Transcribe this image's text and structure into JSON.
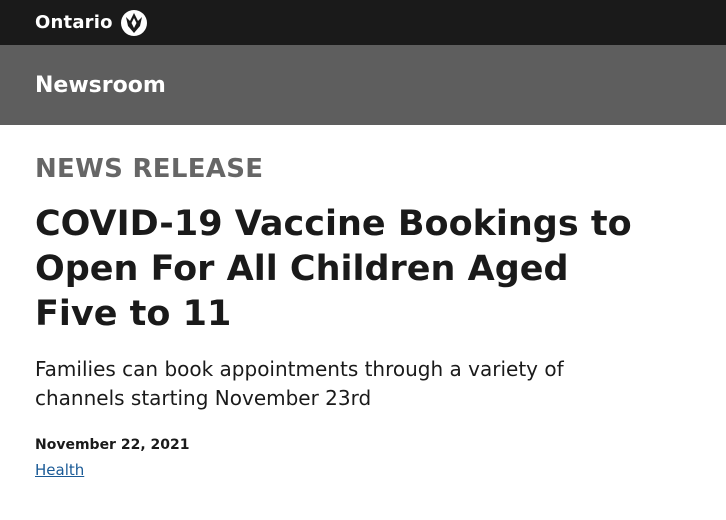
{
  "header": {
    "brand": "Ontario",
    "logo_icon": "ontario-trillium-icon",
    "colors": {
      "background": "#1a1a1a",
      "text": "#ffffff"
    }
  },
  "newsbar": {
    "title": "Newsroom",
    "colors": {
      "background": "#5e5e5e",
      "text": "#ffffff"
    }
  },
  "article": {
    "label": "NEWS RELEASE",
    "headline": "COVID-19 Vaccine Bookings to Open For All Children Aged Five to 11",
    "subtitle": "Families can book appointments through a variety of channels starting November 23rd",
    "date": "November 22, 2021",
    "topic": "Health",
    "colors": {
      "label": "#666666",
      "link": "#1a5a96"
    }
  }
}
